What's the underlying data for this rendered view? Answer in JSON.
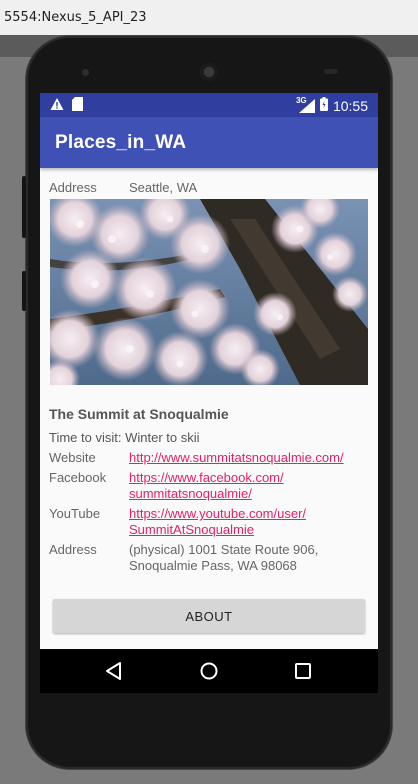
{
  "emulator": {
    "title": "5554:Nexus_5_API_23"
  },
  "status_bar": {
    "network": "3G",
    "time": "10:55"
  },
  "app_bar": {
    "title": "Places_in_WA"
  },
  "header_address": {
    "label": "Address",
    "value": "Seattle, WA"
  },
  "place": {
    "name": "The Summit at Snoqualmie",
    "visit": "Time to visit: Winter to skii"
  },
  "details": [
    {
      "label": "Website",
      "lines": [
        "http://www.summitatsnoqualmie.com/"
      ],
      "link": true
    },
    {
      "label": "Facebook",
      "lines": [
        "https://www.facebook.com/",
        "summitatsnoqualmie/"
      ],
      "link": true
    },
    {
      "label": "YouTube",
      "lines": [
        "https://www.youtube.com/user/",
        "SummitAtSnoqualmie"
      ],
      "link": true
    },
    {
      "label": "Address",
      "lines": [
        "(physical) 1001 State Route 906,",
        "Snoqualmie Pass, WA 98068"
      ],
      "link": false
    }
  ],
  "about_button": {
    "label": "ABOUT"
  },
  "colors": {
    "primary": "#3f51b5",
    "primary_dark": "#303f9f",
    "link": "#e91e63"
  },
  "icons": [
    "warning-icon",
    "sd-card-icon",
    "signal-icon",
    "battery-icon",
    "back-icon",
    "home-icon",
    "recents-icon"
  ]
}
